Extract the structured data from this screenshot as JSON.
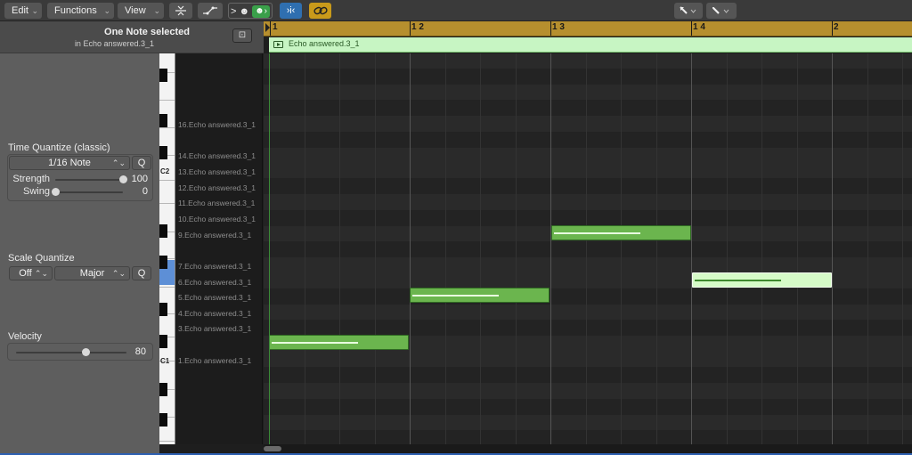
{
  "toolbar": {
    "menus": [
      {
        "label": "Edit"
      },
      {
        "label": "Functions"
      },
      {
        "label": "View"
      }
    ],
    "midi_in_label": ">",
    "midi_in_glyph": "☻",
    "catch_label": "›Ꭵ‹"
  },
  "inspector": {
    "selection_title": "One Note selected",
    "selection_subtitle": "in Echo answered.3_1",
    "time_quantize": {
      "title": "Time Quantize (classic)",
      "value": "1/16 Note",
      "q_button": "Q",
      "strength_label": "Strength",
      "strength_value": "100",
      "strength_level": 1.0,
      "swing_label": "Swing",
      "swing_value": "0",
      "swing_level": 0.0
    },
    "scale_quantize": {
      "title": "Scale Quantize",
      "root_value": "Off",
      "scale_value": "Major",
      "q_button": "Q"
    },
    "velocity": {
      "title": "Velocity",
      "value": "80",
      "level": 0.63
    }
  },
  "keyboard": {
    "labels": [
      "C2",
      "C1"
    ]
  },
  "note_names": [
    "16.Echo answered.3_1",
    "14.Echo answered.3_1",
    "13.Echo answered.3_1",
    "12.Echo answered.3_1",
    "11.Echo answered.3_1",
    "10.Echo answered.3_1",
    "9.Echo answered.3_1",
    "7.Echo answered.3_1",
    "6.Echo answered.3_1",
    "5.Echo answered.3_1",
    "4.Echo answered.3_1",
    "3.Echo answered.3_1",
    "1.Echo answered.3_1"
  ],
  "ruler": {
    "bars": [
      "1",
      "1 2",
      "1 3",
      "1 4",
      "2"
    ]
  },
  "region": {
    "name": "Echo answered.3_1",
    "color": "#c7f5c3"
  },
  "colors": {
    "note": "#6bb54e",
    "note_selected": "#d6fbc8",
    "ruler": "#b68f2e",
    "keyboard_highlight": "#5d8fd6"
  }
}
